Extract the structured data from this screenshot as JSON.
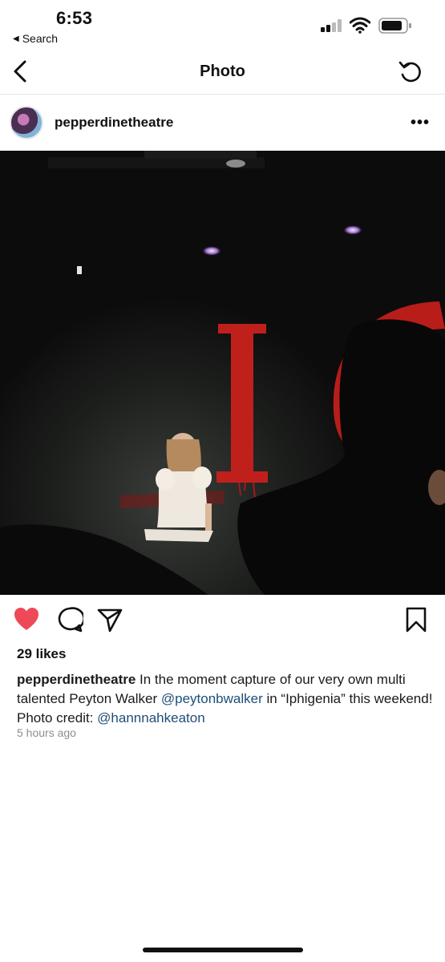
{
  "status_bar": {
    "time": "6:53",
    "back_app_label": "Search"
  },
  "nav": {
    "title": "Photo"
  },
  "post": {
    "username": "pepperdinetheatre",
    "likes": "29 likes",
    "caption": {
      "username": "pepperdinetheatre",
      "text_1": " In the moment capture of our very own multi talented Peyton Walker ",
      "mention_1": "@peytonbwalker",
      "text_2": " in “Iphigenia” this weekend! Photo credit:  ",
      "mention_2": "@hannnahkeaton"
    },
    "timestamp": "5 hours ago"
  },
  "colors": {
    "like_red": "#ed4956",
    "mention_blue": "#1f4e79",
    "stage_red": "#c0201c"
  },
  "icons": {
    "back": "chevron-left-icon",
    "refresh": "refresh-icon",
    "more": "more-horizontal-icon",
    "like": "heart-icon",
    "comment": "comment-icon",
    "share": "send-icon",
    "save": "bookmark-icon"
  }
}
